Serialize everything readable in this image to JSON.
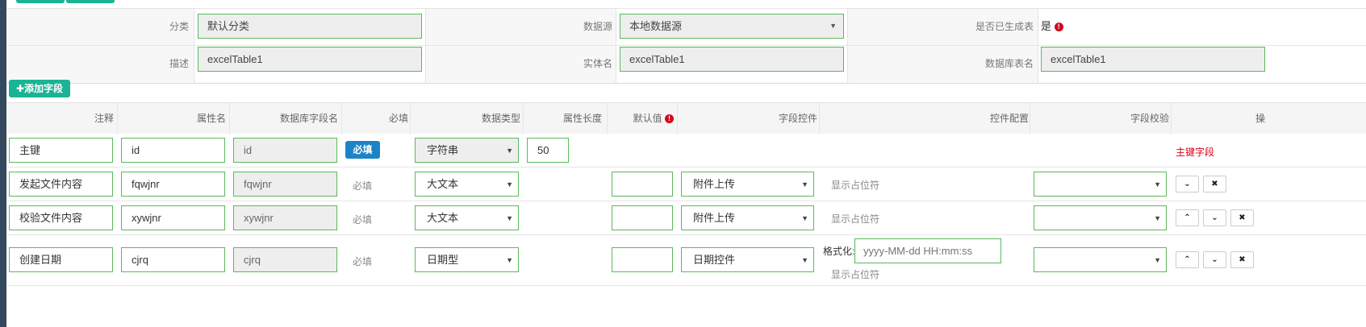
{
  "form": {
    "category_label": "分类",
    "category_value": "默认分类",
    "datasource_label": "数据源",
    "datasource_value": "本地数据源",
    "generated_label": "是否已生成表",
    "generated_value": "是",
    "required_mark": "!",
    "description_label": "描述",
    "description_value": "excelTable1",
    "entity_label": "实体名",
    "entity_value": "excelTable1",
    "dbtable_label": "数据库表名",
    "dbtable_value": "excelTable1"
  },
  "toolbar": {
    "add_field_label": "✚添加字段"
  },
  "table": {
    "headers": {
      "comment": "注释",
      "attr": "属性名",
      "dbfield": "数据库字段名",
      "required": "必填",
      "dtype": "数据类型",
      "length": "属性长度",
      "default": "默认值",
      "control": "字段控件",
      "config": "控件配置",
      "validate": "字段校验",
      "ops": "操作"
    },
    "rows": [
      {
        "comment": "主键",
        "attr": "id",
        "dbfield": "id",
        "required": "必填",
        "dtype": "字符串",
        "length": "50",
        "default": "",
        "control": "",
        "config": "",
        "validate": "",
        "note": "主键字段"
      },
      {
        "comment": "发起文件内容",
        "attr": "fqwjnr",
        "dbfield": "fqwjnr",
        "required": "必填",
        "dtype": "大文本",
        "length": "",
        "default": "",
        "control": "附件上传",
        "config": "显示占位符",
        "validate": ""
      },
      {
        "comment": "校验文件内容",
        "attr": "xywjnr",
        "dbfield": "xywjnr",
        "required": "必填",
        "dtype": "大文本",
        "length": "",
        "default": "",
        "control": "附件上传",
        "config": "显示占位符",
        "validate": ""
      },
      {
        "comment": "创建日期",
        "attr": "cjrq",
        "dbfield": "cjrq",
        "required": "必填",
        "dtype": "日期型",
        "length": "",
        "default": "",
        "control": "日期控件",
        "format_label": "格式化:",
        "format_placeholder": "yyyy-MM-dd HH:mm:ss",
        "config": "显示占位符",
        "validate": ""
      }
    ]
  },
  "icons": {
    "chevron_down": "⌄",
    "chevron_up": "⌃",
    "close": "✖",
    "select_caret": "▼"
  }
}
